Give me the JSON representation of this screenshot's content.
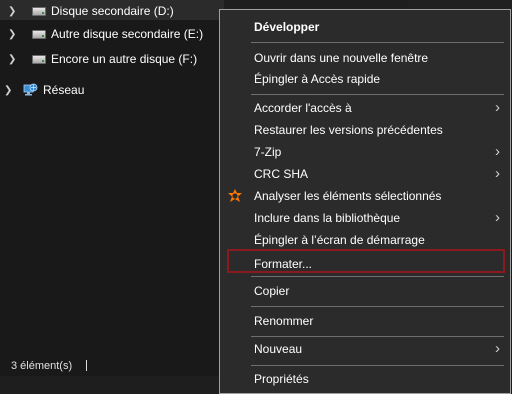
{
  "nav": {
    "items": [
      {
        "label": "Disque secondaire (D:)"
      },
      {
        "label": "Autre disque secondaire (E:)"
      },
      {
        "label": "Encore un autre disque (F:)"
      },
      {
        "label": "Réseau"
      }
    ]
  },
  "status": {
    "count": "3 élément(s)"
  },
  "menu": {
    "items": {
      "developper": "Développer",
      "ouvrir_fenetre": "Ouvrir dans une nouvelle fenêtre",
      "epingler_acces": "Épingler à Accès rapide",
      "accorder": "Accorder l'accès à",
      "restaurer": "Restaurer les versions précédentes",
      "zip": "7-Zip",
      "crc": "CRC SHA",
      "analyser": "Analyser les éléments sélectionnés",
      "inclure": "Inclure dans la bibliothèque",
      "epingler_ecran": "Épingler à l’écran de démarrage",
      "formater": "Formater...",
      "copier": "Copier",
      "renommer": "Renommer",
      "nouveau": "Nouveau",
      "proprietes": "Propriétés"
    },
    "submenu_arrow": "›"
  },
  "colors": {
    "highlight_border": "#8b1a1f",
    "menu_bg": "#2b2b2b",
    "avast_orange": "#ff7800"
  }
}
